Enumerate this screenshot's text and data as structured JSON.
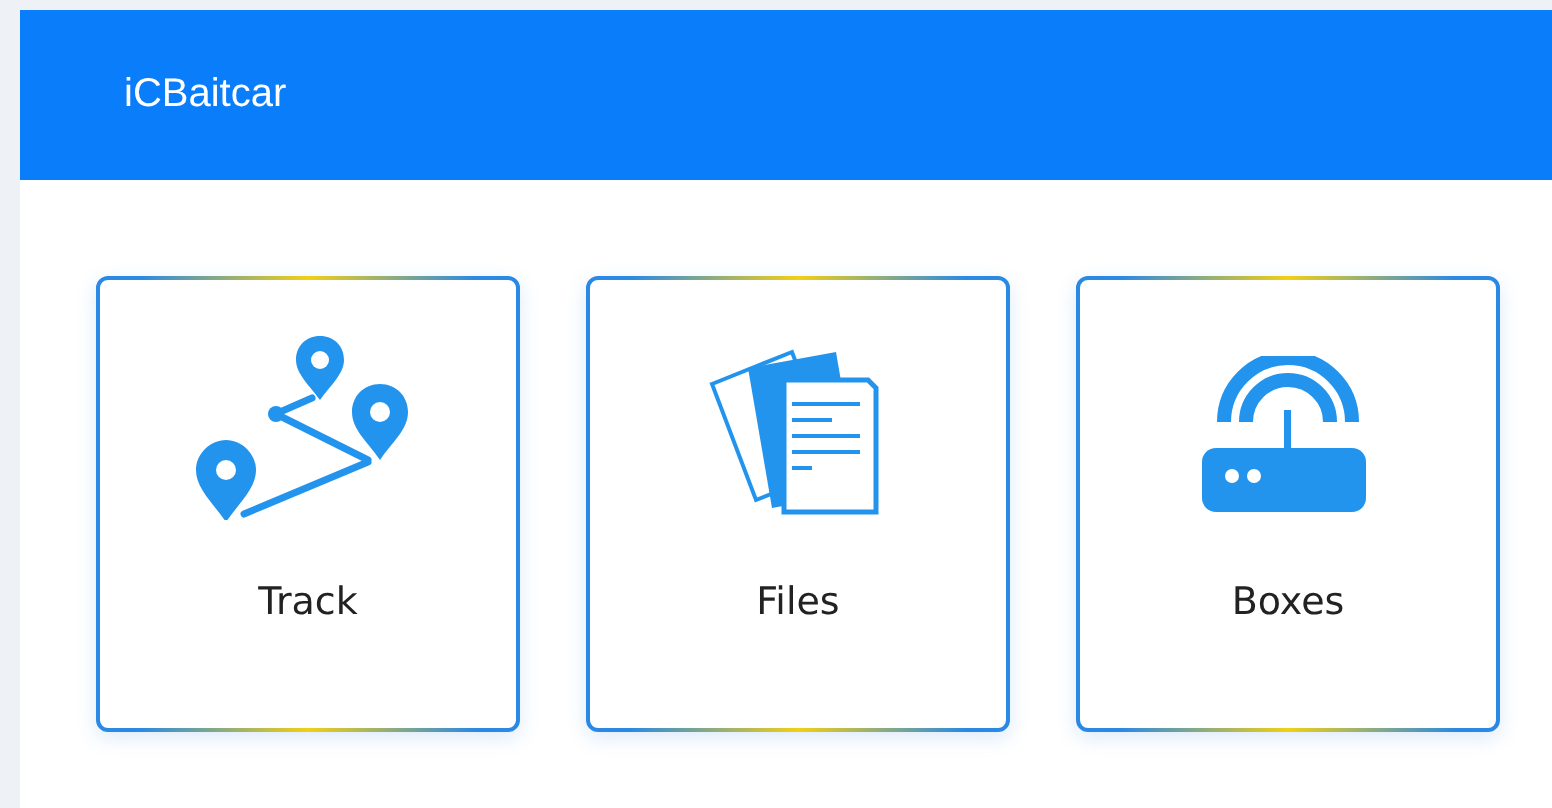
{
  "header": {
    "title": "iCBaitcar"
  },
  "tiles": [
    {
      "kind": "track",
      "label": "Track"
    },
    {
      "kind": "files",
      "label": "Files"
    },
    {
      "kind": "router",
      "label": "Boxes"
    }
  ]
}
